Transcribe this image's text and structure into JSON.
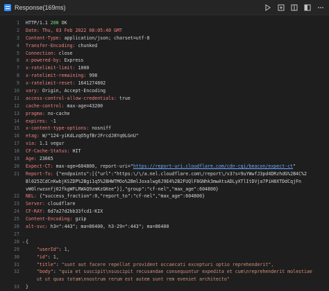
{
  "titlebar": {
    "title": "Response(169ms)"
  },
  "toolbar": {
    "icons": [
      "play-icon",
      "split-icon",
      "layout-icon",
      "collapse-icon",
      "more-icon"
    ]
  },
  "headers": {
    "status_prefix": "HTTP/1.1 ",
    "status_code": "200",
    "status_text": " OK",
    "date_line": "Date: Thu, 03 Feb 2022 08:05:40 GMT",
    "rows": [
      {
        "k": "Content-Type",
        "v": "application/json; charset=utf-8"
      },
      {
        "k": "Transfer-Encoding",
        "v": "chunked"
      },
      {
        "k": "Connection",
        "v": "close"
      },
      {
        "k": "x-powered-by",
        "v": "Express"
      },
      {
        "k": "x-ratelimit-limit",
        "v": "1000"
      },
      {
        "k": "x-ratelimit-remaining",
        "v": "998"
      },
      {
        "k": "x-ratelimit-reset",
        "v": "1641274802"
      },
      {
        "k": "vary",
        "v": "Origin, Accept-Encoding"
      },
      {
        "k": "access-control-allow-credentials",
        "v": "true"
      },
      {
        "k": "cache-control",
        "v": "max-age=43200"
      },
      {
        "k": "pragma",
        "v": "no-cache"
      },
      {
        "k": "expires",
        "v": "-1"
      },
      {
        "k": "x-content-type-options",
        "v": "nosniff"
      },
      {
        "k": "etag",
        "v": "W/\"124-yiKdLzqO5gfBrJFrcdJ8Yq0LGnU\""
      },
      {
        "k": "via",
        "v": "1.1 vegur"
      },
      {
        "k": "CF-Cache-Status",
        "v": "HIT"
      },
      {
        "k": "Age",
        "v": "23665"
      }
    ],
    "expect_ct_key": "Expect-CT",
    "expect_ct_pre": "max-age=604800, report-uri=\"",
    "expect_ct_link": "https://report-uri.cloudflare.com/cdn-cgi/beacon/expect-ct",
    "expect_ct_post": "\"",
    "report_to_key": "Report-To",
    "report_to_line1": "{\"endpoints\":[{\"url\":\"https:\\/\\/a.nel.cloudflare.com\\/report\\/v3?s=9uYWwfJ3pd4DRzhdG%2B4C%2",
    "report_to_line2": "Bl025ZCdCnKwbjKSZDP%2Bgi1q5%2BHWTMOo%2BmlJoxalwg6J9E4%2B2FUQlF8GNhk3mwAtsADLyXTlItDVja7PiH8XTDdCqjFn",
    "report_to_line3": "vW0lrwzxnfj02fkgWFLRWAQ9zmKzGKee\"}],\"group\":\"cf-nel\",\"max_age\":604800}",
    "rows_after": [
      {
        "k": "NEL",
        "v": "{\"success_fraction\":0,\"report_to\":\"cf-nel\",\"max_age\":604800}"
      },
      {
        "k": "Server",
        "v": "cloudflare"
      },
      {
        "k": "CF-RAY",
        "v": "6d7a27d2bb33fcd1-KIX"
      },
      {
        "k": "Content-Encoding",
        "v": "gzip"
      },
      {
        "k": "alt-svc",
        "v": "h3=\":443\"; ma=86400, h3-29=\":443\"; ma=86400"
      }
    ]
  },
  "body": {
    "open": "{",
    "fields": [
      {
        "key": "\"userId\"",
        "value": "1",
        "type": "number"
      },
      {
        "key": "\"id\"",
        "value": "1",
        "type": "number"
      },
      {
        "key": "\"title\"",
        "value": "\"sunt aut facere repellat provident occaecati excepturi optio reprehenderit\"",
        "type": "string"
      },
      {
        "key": "\"body\"",
        "value": "\"quia et suscipit\\nsuscipit recusandae consequuntur expedita et cum\\nreprehenderit molestiae",
        "type": "string"
      }
    ],
    "body_cont": "ut ut quas totam\\nnostrum rerum est autem sunt rem eveniet architecto\"",
    "close": "}"
  }
}
